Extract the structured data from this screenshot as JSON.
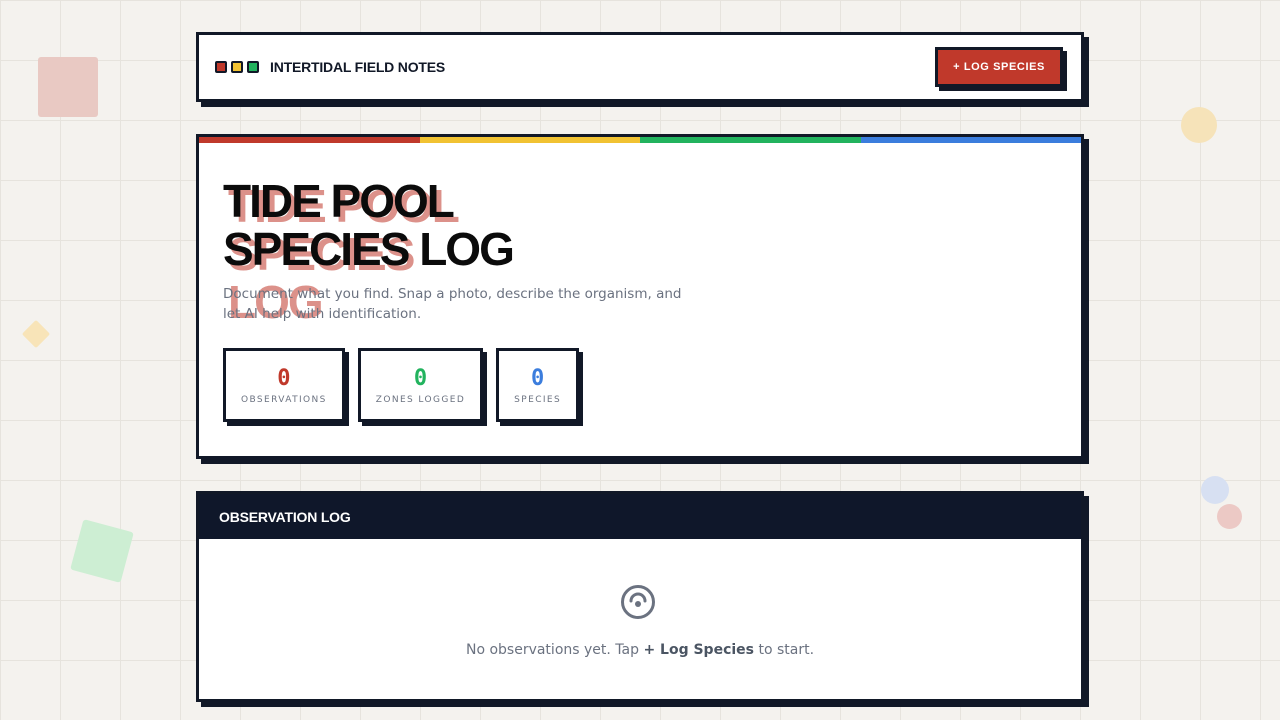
{
  "header": {
    "title": "INTERTIDAL FIELD NOTES",
    "log_button": "+ LOG SPECIES"
  },
  "hero": {
    "title_line1": "TIDE POOL",
    "title_line2": "SPECIES LOG",
    "shadow_text": "TIDE POOL SPECIES LOG",
    "subtitle": "Document what you find. Snap a photo, describe the organism, and let AI help with identification."
  },
  "stats": [
    {
      "value": "0",
      "label": "OBSERVATIONS"
    },
    {
      "value": "0",
      "label": "ZONES LOGGED"
    },
    {
      "value": "0",
      "label": "SPECIES"
    }
  ],
  "observation_log": {
    "title": "OBSERVATION LOG",
    "empty_before": "No observations yet. Tap ",
    "empty_action": "+ Log Species",
    "empty_after": " to start.",
    "empty_icon": "empty-face-icon"
  },
  "colors": {
    "red": "#c0392b",
    "yellow": "#f1c232",
    "green": "#22b35e",
    "blue": "#3b7ddd",
    "ink": "#111827",
    "navy": "#0f172a"
  }
}
